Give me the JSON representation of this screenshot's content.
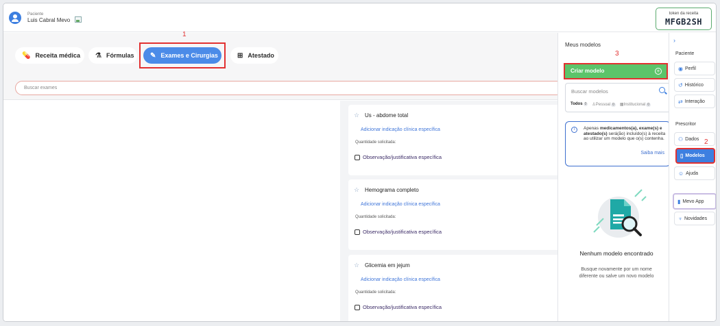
{
  "header": {
    "patient_label": "Paciente",
    "patient_name": "Luis Cabral Mevo",
    "token_label": "token da receita",
    "token_value": "MFGB2SH"
  },
  "tabs": [
    {
      "label": "Receita médica",
      "icon": "pills-icon"
    },
    {
      "label": "Fórmulas",
      "icon": "flask-icon"
    },
    {
      "label": "Exames e Cirurgias",
      "icon": "syringe-icon",
      "active": true
    },
    {
      "label": "Atestado",
      "icon": "document-plus-icon"
    }
  ],
  "annotations": [
    "1",
    "2",
    "3"
  ],
  "search_exams": {
    "placeholder": "Buscar exames"
  },
  "exam_cards": [
    {
      "title": "Us - abdome total",
      "link": "Adicionar indicação clínica específica",
      "qty_label": "Quantidade solicitada:",
      "obs_label": "Observação/justificativa específica"
    },
    {
      "title": "Hemograma completo",
      "link": "Adicionar indicação clínica específica",
      "qty_label": "Quantidade solicitada:",
      "obs_label": "Observação/justificativa específica"
    },
    {
      "title": "Glicemia em jejum",
      "link": "Adicionar indicação clínica específica",
      "qty_label": "Quantidade solicitada:",
      "obs_label": "Observação/justificativa específica"
    }
  ],
  "models_panel": {
    "title": "Meus modelos",
    "create_button": "Criar modelo",
    "search_placeholder": "Buscar modelos",
    "filters": [
      {
        "label": "Todos",
        "count": "0"
      },
      {
        "label": "Pessoal",
        "count": "0"
      },
      {
        "label": "Institucional",
        "count": "0"
      }
    ],
    "info_text_1": "Apenas ",
    "info_text_bold_1": "medicamentos(a), exame(s) e atestado(s)",
    "info_text_2": " será(ão) incluído(s) à receita ao utilizar um modelo que o(s) contenha.",
    "info_link": "Saiba mais",
    "empty_title": "Nenhum modelo encontrado",
    "empty_subtitle": "Busque novamente por um nome diferente ou salve um novo modelo"
  },
  "right_nav": {
    "section_patient": "Paciente",
    "section_prescriber": "Prescritor",
    "items": [
      {
        "label": "Perfil",
        "icon": "person-circle-icon"
      },
      {
        "label": "Histórico",
        "icon": "history-icon"
      },
      {
        "label": "Interação",
        "icon": "arrows-icon"
      },
      {
        "label": "Dados",
        "icon": "data-icon"
      },
      {
        "label": "Modelos",
        "icon": "document-icon",
        "active": true
      },
      {
        "label": "Ajuda",
        "icon": "help-icon"
      },
      {
        "label": "Mevo App",
        "icon": "phone-icon"
      },
      {
        "label": "Novidades",
        "icon": "gift-icon"
      }
    ]
  },
  "colors": {
    "accent": "#3d7fe0",
    "tab_active": "#4b8be8",
    "create_button": "#5cc46a",
    "annotation": "#e23030"
  }
}
